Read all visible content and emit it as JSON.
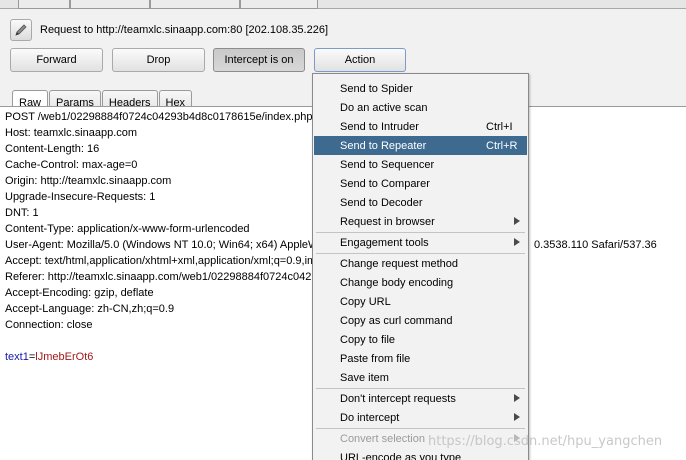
{
  "request": {
    "target_label": "Request to http://teamxlc.sinaapp.com:80  [202.108.35.226]"
  },
  "toolbar": {
    "forward": "Forward",
    "drop": "Drop",
    "intercept": "Intercept is on",
    "action": "Action"
  },
  "tabs": [
    "Raw",
    "Params",
    "Headers",
    "Hex"
  ],
  "editor": {
    "lines": [
      "POST /web1/02298884f0724c04293b4d8c0178615e/index.php",
      "Host: teamxlc.sinaapp.com",
      "Content-Length: 16",
      "Cache-Control: max-age=0",
      "Origin: http://teamxlc.sinaapp.com",
      "Upgrade-Insecure-Requests: 1",
      "DNT: 1",
      "Content-Type: application/x-www-form-urlencoded",
      "User-Agent: Mozilla/5.0 (Windows NT 10.0; Win64; x64) AppleW",
      "Accept: text/html,application/xhtml+xml,application/xml;q=0.9,ima",
      "Referer: http://teamxlc.sinaapp.com/web1/02298884f0724c042",
      "Accept-Encoding: gzip, deflate",
      "Accept-Language: zh-CN,zh;q=0.9",
      "Connection: close"
    ],
    "ua_tail": "0.3538.110 Safari/537.36",
    "body_param_name": "text1",
    "body_equals": "=",
    "body_param_value": "lJmebErOt6"
  },
  "context_menu": {
    "items": [
      {
        "label": "Send to Spider"
      },
      {
        "label": "Do an active scan"
      },
      {
        "label": "Send to Intruder",
        "shortcut": "Ctrl+I"
      },
      {
        "label": "Send to Repeater",
        "shortcut": "Ctrl+R"
      },
      {
        "label": "Send to Sequencer"
      },
      {
        "label": "Send to Comparer"
      },
      {
        "label": "Send to Decoder"
      },
      {
        "label": "Request in browser"
      },
      {
        "label": "Engagement tools"
      },
      {
        "label": "Change request method"
      },
      {
        "label": "Change body encoding"
      },
      {
        "label": "Copy URL"
      },
      {
        "label": "Copy as curl command"
      },
      {
        "label": "Copy to file"
      },
      {
        "label": "Paste from file"
      },
      {
        "label": "Save item"
      },
      {
        "label": "Don't intercept requests"
      },
      {
        "label": "Do intercept"
      },
      {
        "label": "Convert selection"
      },
      {
        "label": "URL-encode as you type"
      }
    ],
    "selected": "Send to Repeater"
  },
  "watermark": "https://blog.csdn.net/hpu_yangchen",
  "colors": {
    "selection": "#3e6a8f",
    "param_name": "#1a1aa6",
    "param_value": "#a11919"
  }
}
